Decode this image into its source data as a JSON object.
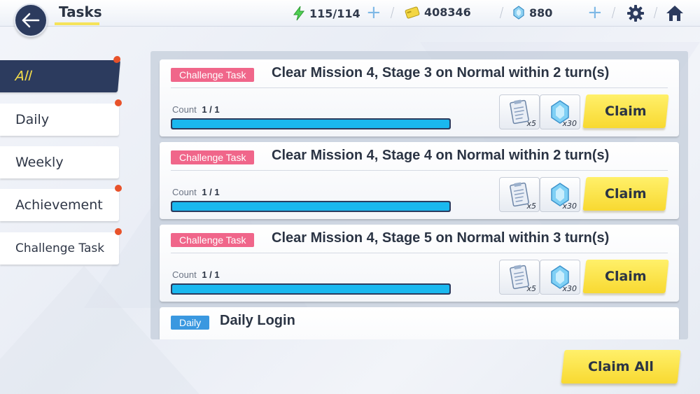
{
  "header": {
    "title": "Tasks",
    "stamina": "115/114",
    "credits": "408346",
    "gems": "880"
  },
  "icons": {
    "back": "arrow-left-icon",
    "stamina": "lightning-bolt-icon",
    "credits": "credit-card-icon",
    "gems": "crystal-gem-icon",
    "settings": "gear-icon",
    "home": "home-icon",
    "reward_item": "clipboard-report-icon",
    "reward_gem": "blue-crystal-icon"
  },
  "sidebar": {
    "items": [
      {
        "label": "All",
        "active": true,
        "notify": true
      },
      {
        "label": "Daily",
        "active": false,
        "notify": true
      },
      {
        "label": "Weekly",
        "active": false,
        "notify": false
      },
      {
        "label": "Achievement",
        "active": false,
        "notify": true
      },
      {
        "label": "Challenge Task",
        "active": false,
        "notify": true
      }
    ]
  },
  "tasks": [
    {
      "category": "Challenge Task",
      "title": "Clear Mission 4, Stage 3 on Normal within 2 turn(s)",
      "count_label": "Count",
      "count": "1 / 1",
      "progress": 1.0,
      "rewards": [
        {
          "icon": "clipboard-report-icon",
          "qty": "x5"
        },
        {
          "icon": "blue-crystal-icon",
          "qty": "x30"
        }
      ],
      "button": "Claim"
    },
    {
      "category": "Challenge Task",
      "title": "Clear Mission 4, Stage 4 on Normal within 2 turn(s)",
      "count_label": "Count",
      "count": "1 / 1",
      "progress": 1.0,
      "rewards": [
        {
          "icon": "clipboard-report-icon",
          "qty": "x5"
        },
        {
          "icon": "blue-crystal-icon",
          "qty": "x30"
        }
      ],
      "button": "Claim"
    },
    {
      "category": "Challenge Task",
      "title": "Clear Mission 4, Stage 5 on Normal within 3 turn(s)",
      "count_label": "Count",
      "count": "1 / 1",
      "progress": 1.0,
      "rewards": [
        {
          "icon": "clipboard-report-icon",
          "qty": "x5"
        },
        {
          "icon": "blue-crystal-icon",
          "qty": "x30"
        }
      ],
      "button": "Claim"
    },
    {
      "category": "Daily",
      "title": "Daily Login"
    }
  ],
  "footer": {
    "claim_all": "Claim All"
  },
  "colors": {
    "navy": "#2c3b5e",
    "accent_yellow": "#f8d931",
    "progress_blue": "#1ab8ef",
    "challenge_badge": "#f0668a",
    "daily_badge": "#3a98e0",
    "notify_dot": "#e8522a"
  }
}
